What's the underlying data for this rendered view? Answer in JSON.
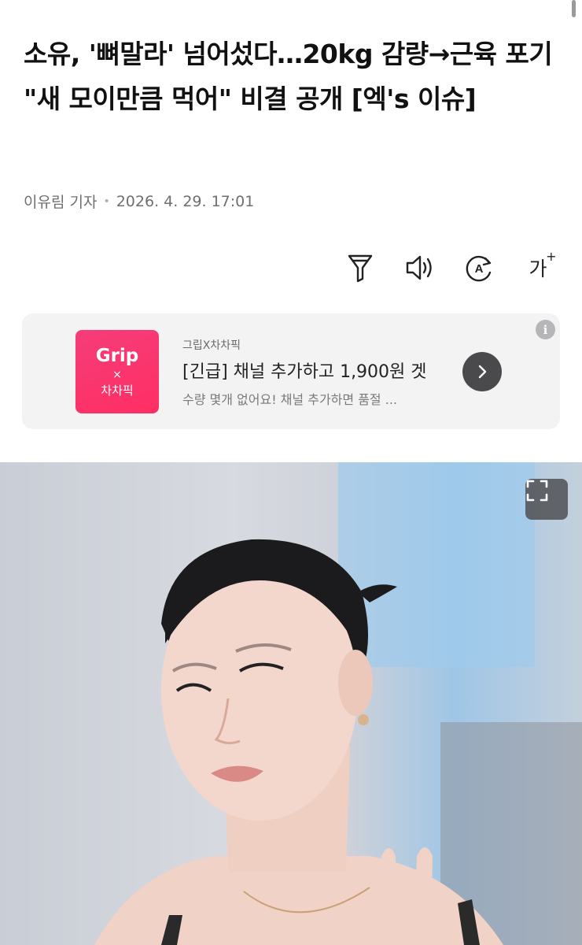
{
  "article": {
    "headline": "소유, '뼈말라' 넘어섰다…20kg 감량→근육 포기 \"새 모이만큼 먹어\" 비결 공개 [엑's 이슈]",
    "reporter": "이유림 기자",
    "date": "2026. 4. 29. 17:01"
  },
  "toolbar": {
    "icons": [
      "filter-icon",
      "speaker-icon",
      "translate-icon",
      "font-size-icon"
    ],
    "font_size_label": "가",
    "font_size_plus": "+",
    "translate_letter": "A"
  },
  "ad": {
    "logo_line1": "Grip",
    "logo_line2": "×",
    "logo_line3": "차차픽",
    "source": "그립X차차픽",
    "title": "[긴급] 채널 추가하고 1,900원 겟",
    "description": "수량 몇개 없어요! 채널 추가하면 품절 ...",
    "info_icon": "i",
    "colors": {
      "brand": "#ff2e63",
      "background": "#f3f3f4"
    }
  },
  "photo": {
    "expand_icon": "expand-icon"
  }
}
